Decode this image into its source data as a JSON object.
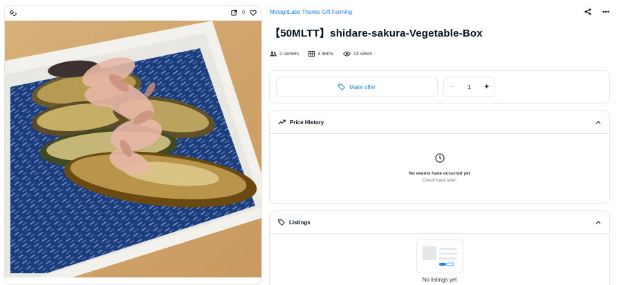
{
  "media": {
    "favorite_count": "0",
    "image_alt": "Grilled eggplant topped with bonito flakes on a blue patterned plate"
  },
  "item": {
    "collection": "MetagriLabo Thanks Gift Farming",
    "title": "【50MLTT】shidare-sakura-Vegetable-Box"
  },
  "stats": {
    "owners": "2 owners",
    "items": "4 items",
    "views": "13 views"
  },
  "offer": {
    "button_label": "Make offer",
    "quantity": "1",
    "minus": "−",
    "plus": "+"
  },
  "price_history": {
    "title": "Price History",
    "empty_title": "No events have occurred yet",
    "empty_sub": "Check back later."
  },
  "listings": {
    "title": "Listings",
    "empty": "No listings yet"
  },
  "colors": {
    "accent": "#2081e2",
    "border": "#e5e8eb",
    "text": "#04111d"
  }
}
